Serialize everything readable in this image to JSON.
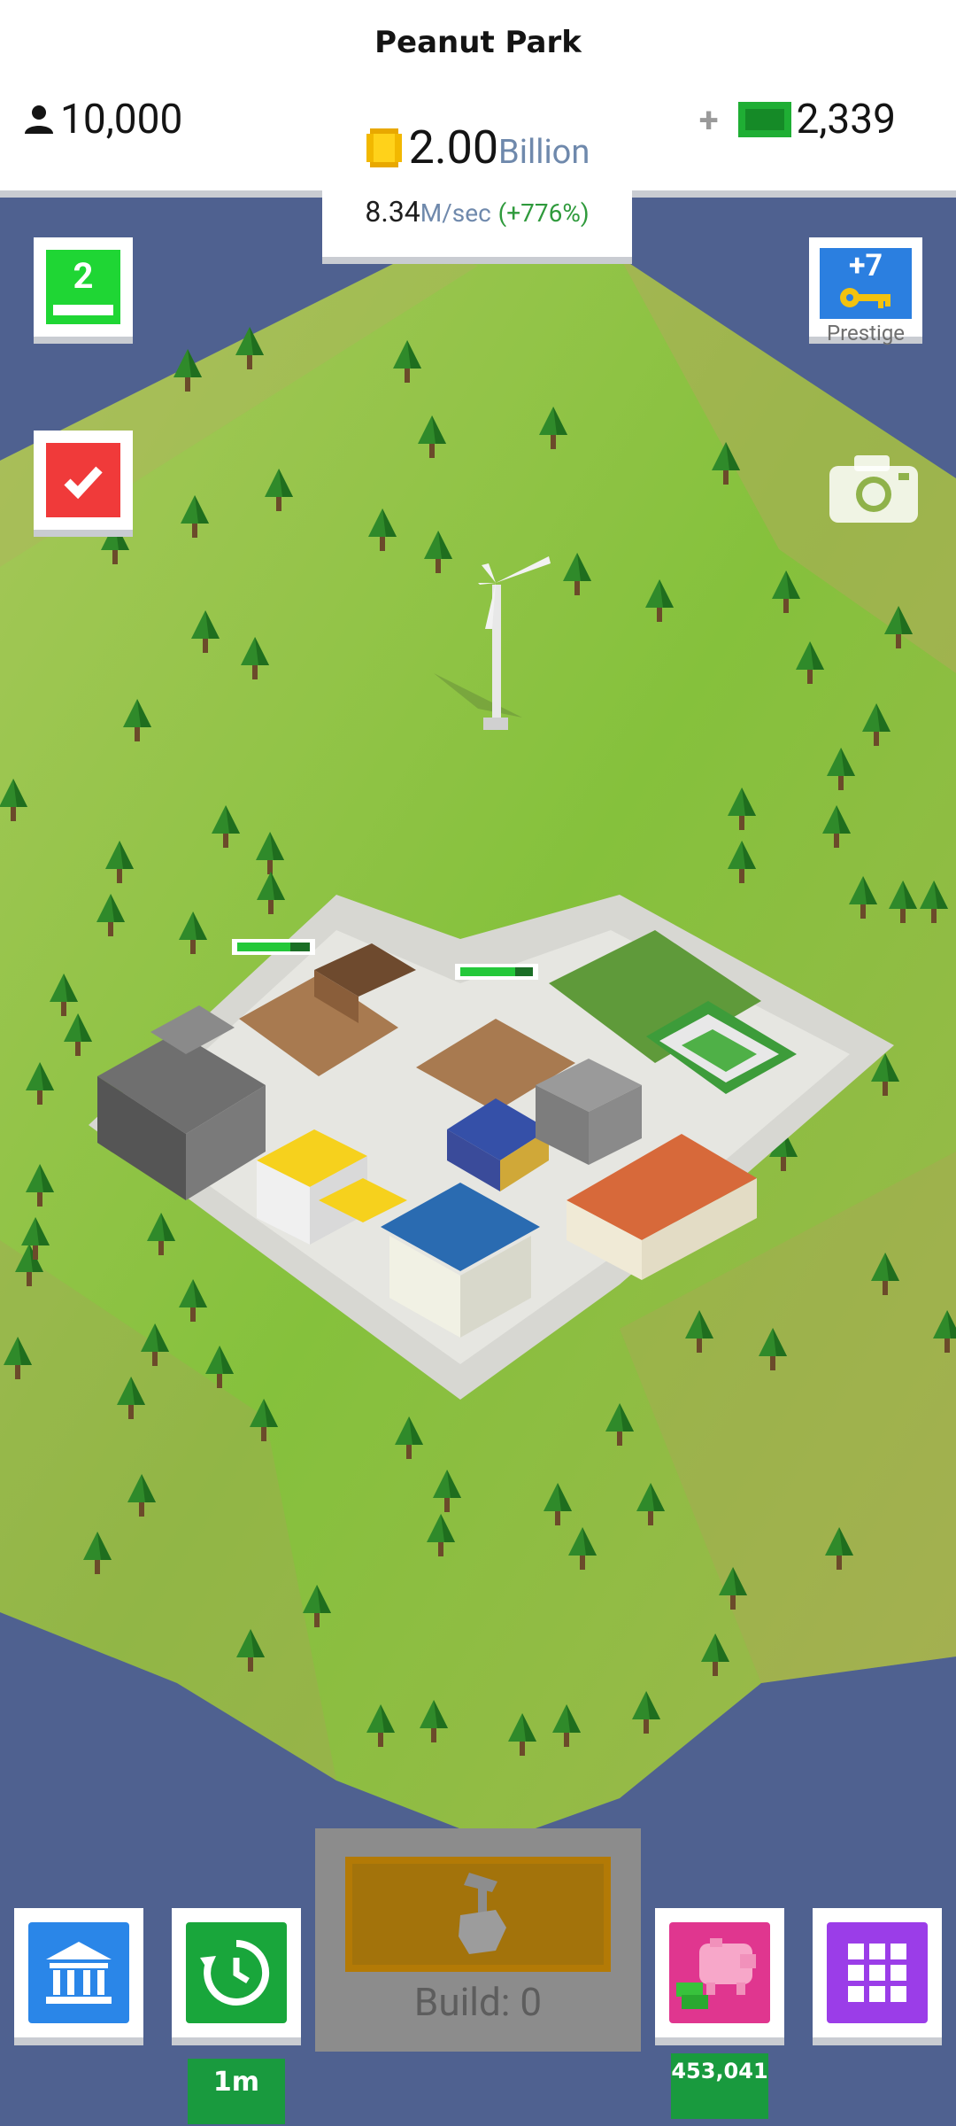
{
  "park": {
    "name": "Peanut Park"
  },
  "population": {
    "value": "10,000",
    "icon": "person-icon"
  },
  "cash": {
    "plus": "+",
    "value": "2,339",
    "icon": "cash-bill-icon"
  },
  "money": {
    "value": "2.00",
    "unit": "Billion",
    "icon": "coin-icon"
  },
  "income": {
    "value": "8.34",
    "unit": "M/sec",
    "percent": "(+776%)"
  },
  "level": {
    "value": "2",
    "progress": 1.0
  },
  "prestige": {
    "count": "+7",
    "label": "Prestige"
  },
  "tasks": {
    "icon": "checkmark-icon"
  },
  "camera": {
    "icon": "camera-icon"
  },
  "build": {
    "label": "Build: 0",
    "icon": "hammer-hand-icon"
  },
  "bottom": {
    "bank_icon": "bank-icon",
    "timer_icon": "clock-refresh-icon",
    "timer_badge": "1m",
    "piggy_icon": "piggy-bank-icon",
    "piggy_badge": "453,041",
    "grid_icon": "grid-menu-icon"
  },
  "colors": {
    "water": "#4f6190",
    "grass": "#7fbf3a",
    "level_green": "#1fd634",
    "tasks_red": "#f03a3a",
    "prestige_blue": "#2b7fe0",
    "bank_blue": "#2a86e8",
    "timer_green": "#19a63b",
    "piggy_pink": "#e0368f",
    "grid_purple": "#9b3de8"
  }
}
